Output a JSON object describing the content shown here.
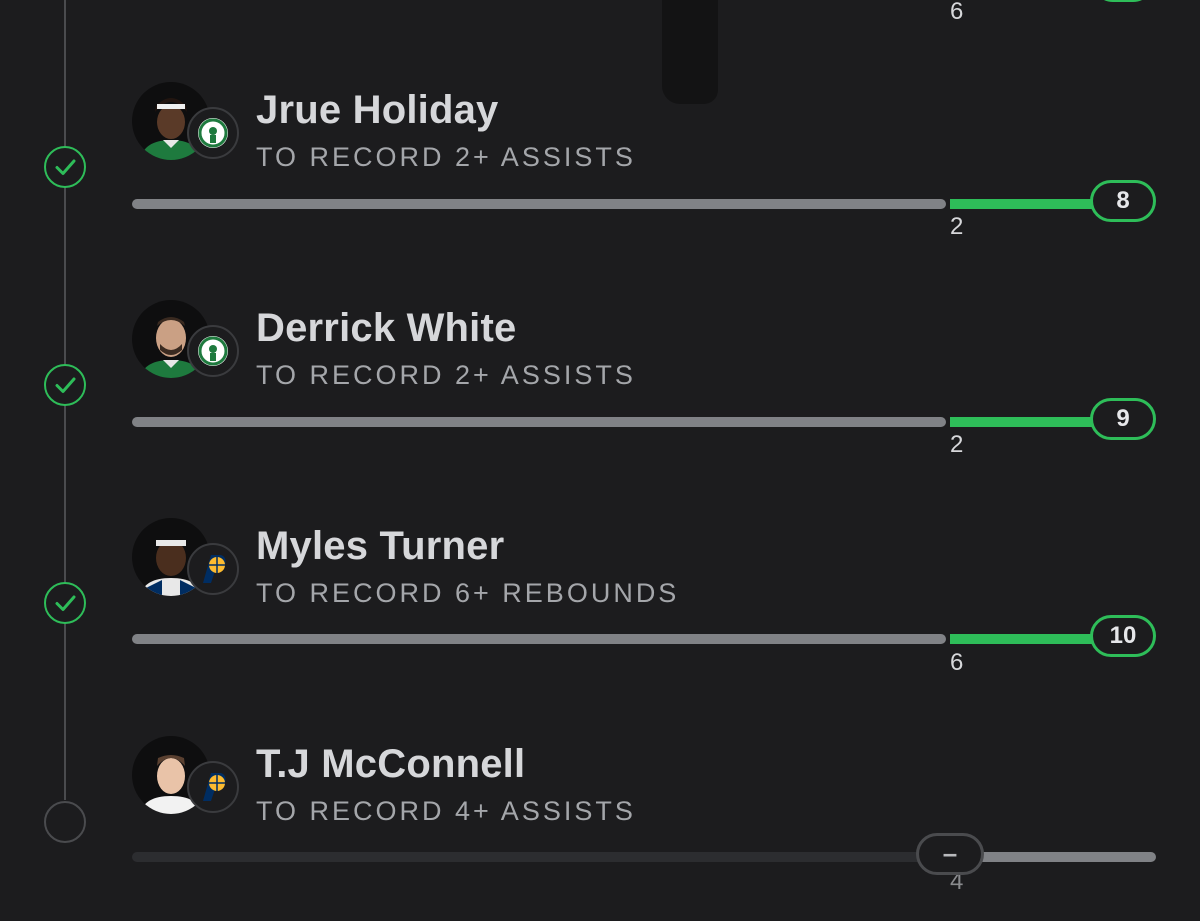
{
  "colors": {
    "background": "#1c1c1e",
    "accent_green": "#2ebd59",
    "track_gray": "#808286",
    "pending_track": "#2c2d30"
  },
  "top_fragment": {
    "line_value": "6"
  },
  "legs": [
    {
      "player": "Jrue Holiday",
      "team_logo": "celtics-logo-icon",
      "prop": "TO RECORD 2+ ASSISTS",
      "status": "hit",
      "status_icon": "check-circle-icon",
      "line": "2",
      "current_stat": "8"
    },
    {
      "player": "Derrick White",
      "team_logo": "celtics-logo-icon",
      "prop": "TO RECORD 2+ ASSISTS",
      "status": "hit",
      "status_icon": "check-circle-icon",
      "line": "2",
      "current_stat": "9"
    },
    {
      "player": "Myles Turner",
      "team_logo": "pacers-logo-icon",
      "prop": "TO RECORD 6+ REBOUNDS",
      "status": "hit",
      "status_icon": "check-circle-icon",
      "line": "6",
      "current_stat": "10"
    },
    {
      "player": "T.J McConnell",
      "team_logo": "pacers-logo-icon",
      "prop": "TO RECORD 4+ ASSISTS",
      "status": "pending",
      "status_icon": "empty-circle-icon",
      "line": "4",
      "current_stat": "–"
    }
  ]
}
